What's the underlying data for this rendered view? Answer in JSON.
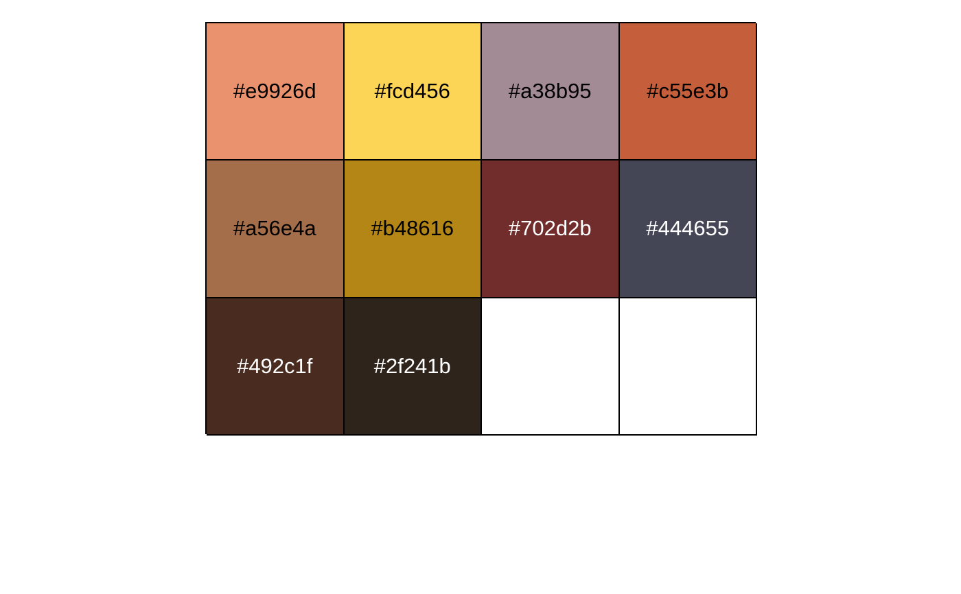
{
  "palette": {
    "swatches": [
      {
        "label": "#e9926d",
        "color": "#e9926d",
        "text_color": "#000000"
      },
      {
        "label": "#fcd456",
        "color": "#fcd456",
        "text_color": "#000000"
      },
      {
        "label": "#a38b95",
        "color": "#a38b95",
        "text_color": "#000000"
      },
      {
        "label": "#c55e3b",
        "color": "#c55e3b",
        "text_color": "#000000"
      },
      {
        "label": "#a56e4a",
        "color": "#a56e4a",
        "text_color": "#000000"
      },
      {
        "label": "#b48616",
        "color": "#b48616",
        "text_color": "#000000"
      },
      {
        "label": "#702d2b",
        "color": "#702d2b",
        "text_color": "#ffffff"
      },
      {
        "label": "#444655",
        "color": "#444655",
        "text_color": "#ffffff"
      },
      {
        "label": "#492c1f",
        "color": "#492c1f",
        "text_color": "#ffffff"
      },
      {
        "label": "#2f241b",
        "color": "#2f241b",
        "text_color": "#ffffff"
      },
      {
        "label": "",
        "color": "#ffffff",
        "text_color": "#000000"
      },
      {
        "label": "",
        "color": "#ffffff",
        "text_color": "#000000"
      }
    ]
  }
}
